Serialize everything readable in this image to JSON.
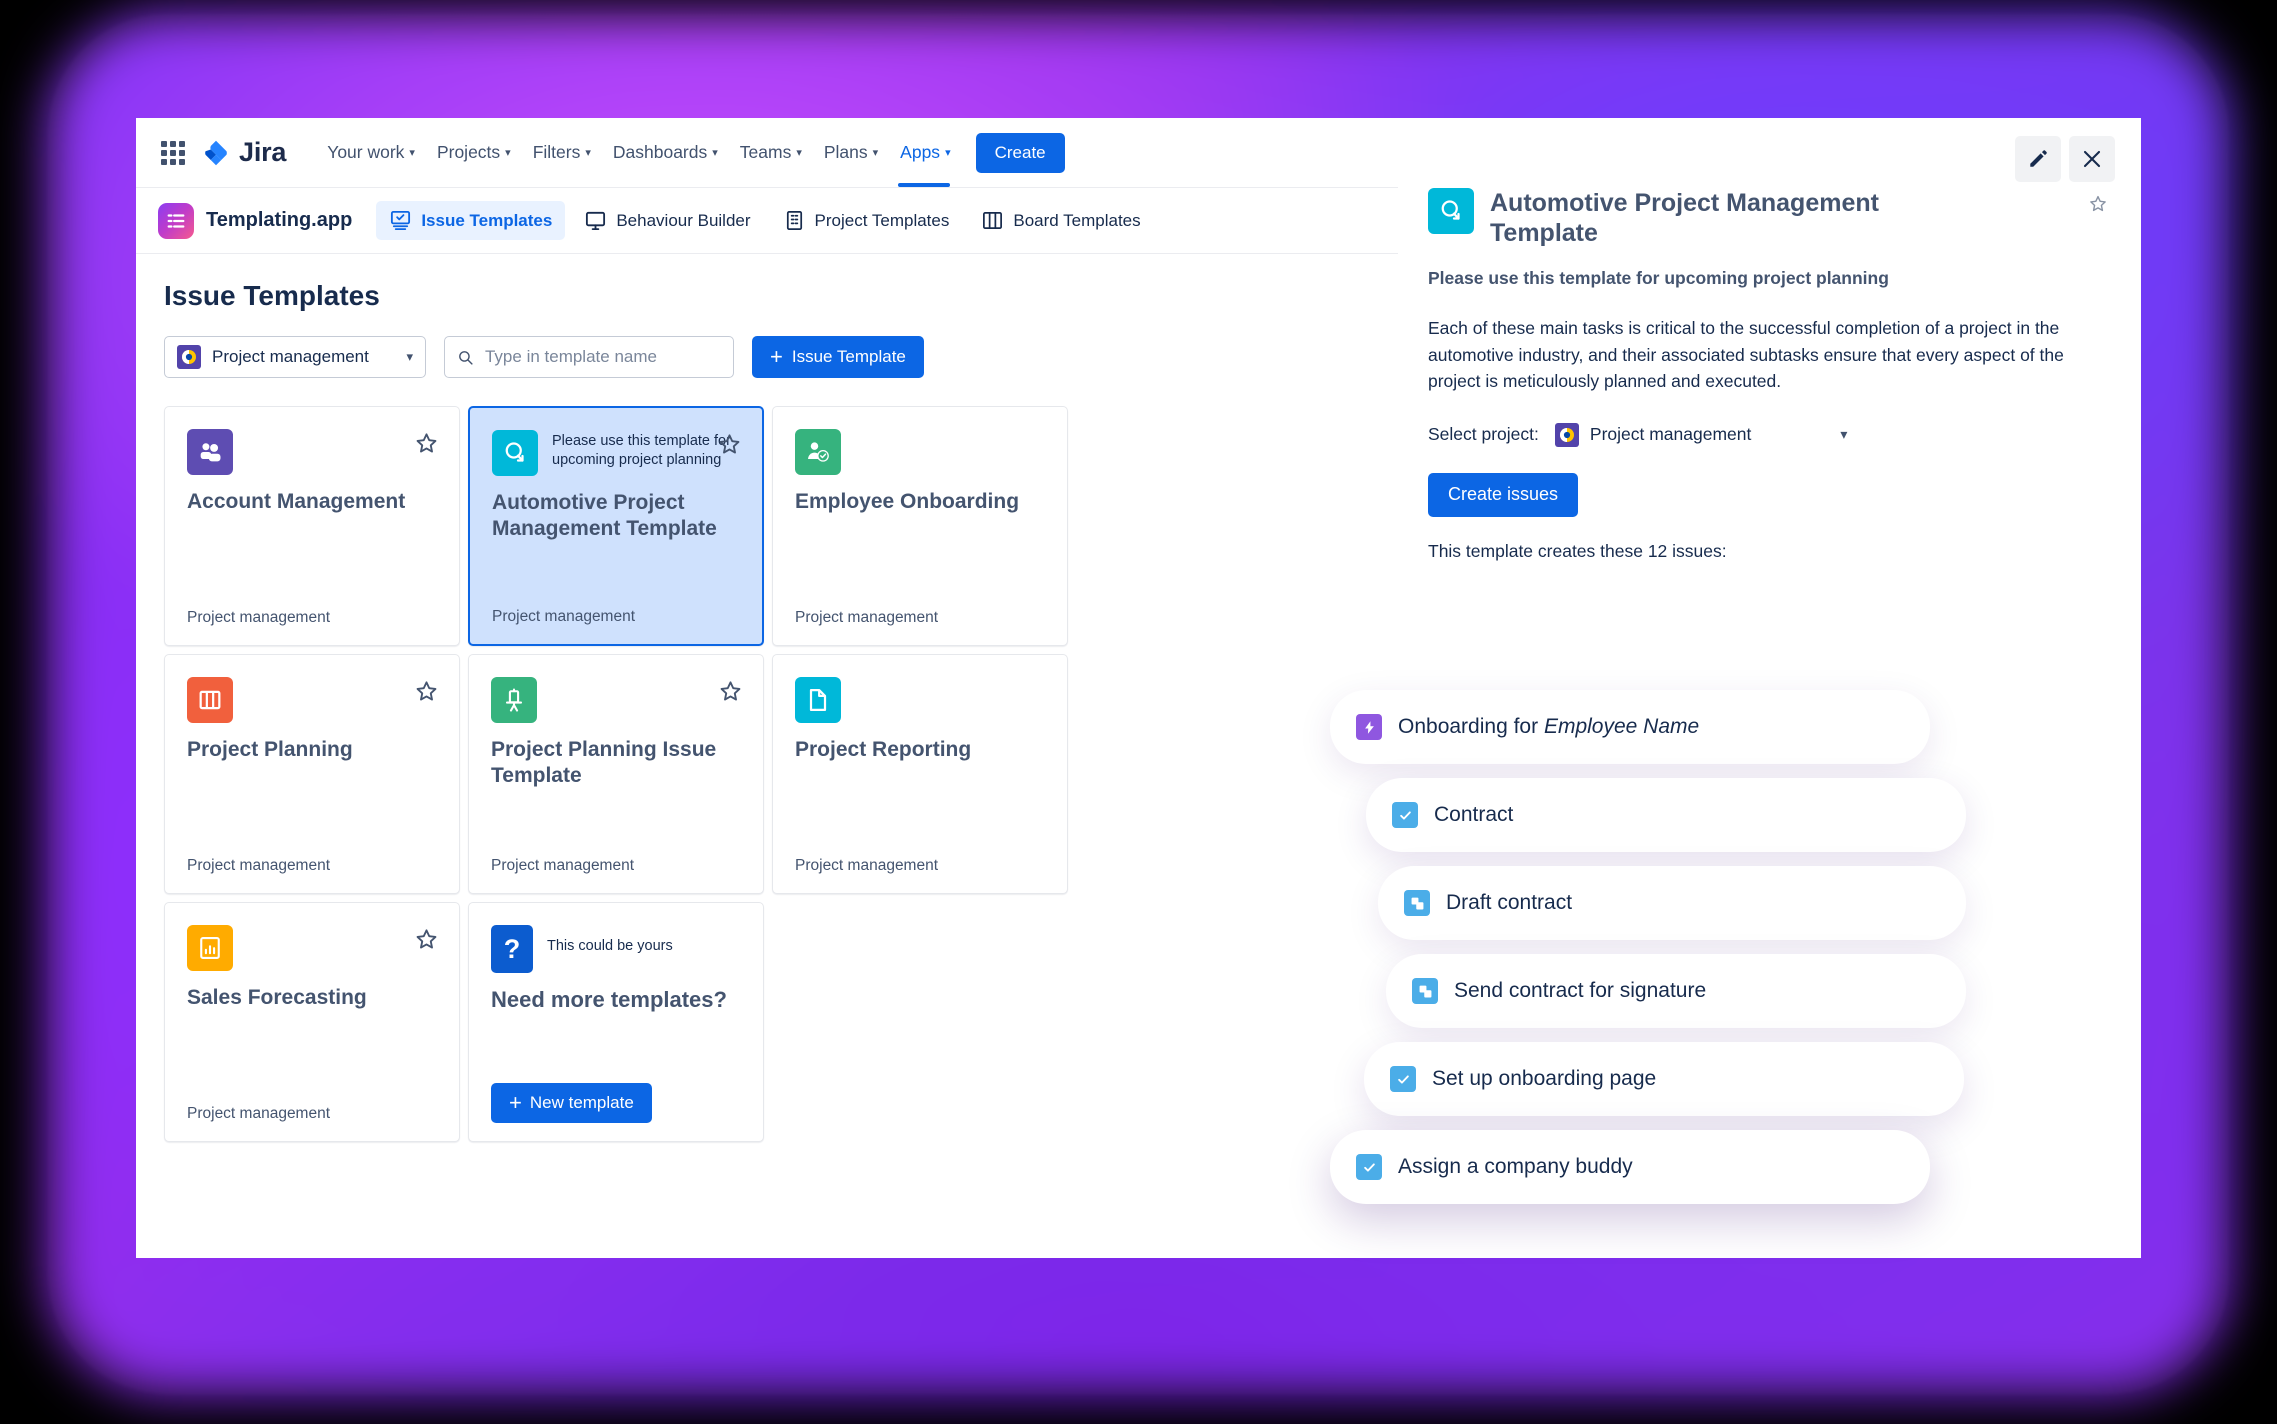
{
  "topnav": {
    "app_switcher": "app-switcher",
    "brand": "Jira",
    "items": [
      {
        "label": "Your work",
        "caret": "⌄",
        "active": false
      },
      {
        "label": "Projects",
        "caret": "⌄",
        "active": false
      },
      {
        "label": "Filters",
        "caret": "⌄",
        "active": false
      },
      {
        "label": "Dashboards",
        "caret": "⌄",
        "active": false
      },
      {
        "label": "Teams",
        "caret": "⌄",
        "active": false
      },
      {
        "label": "Plans",
        "caret": "⌄",
        "active": false
      },
      {
        "label": "Apps",
        "caret": "⌄",
        "active": true
      }
    ],
    "create_label": "Create"
  },
  "apptabs": {
    "app_name": "Templating.app",
    "tabs": [
      {
        "label": "Issue Templates",
        "icon": "issue-templates-icon",
        "active": true
      },
      {
        "label": "Behaviour Builder",
        "icon": "monitor-icon",
        "active": false
      },
      {
        "label": "Project Templates",
        "icon": "building-icon",
        "active": false
      },
      {
        "label": "Board Templates",
        "icon": "columns-icon",
        "active": false
      }
    ]
  },
  "page": {
    "title": "Issue Templates",
    "project_filter": "Project management",
    "search_placeholder": "Type in template name",
    "search_value": "",
    "add_button": "Issue Template"
  },
  "cards": [
    {
      "title": "Account Management",
      "note": "",
      "footer": "Project management",
      "icon": "people-icon",
      "icon_bg": "#5e4db2",
      "selected": false,
      "starred": false
    },
    {
      "title": "Automotive Project Management Template",
      "note": "Please use this template for upcoming project planning",
      "footer": "Project management",
      "icon": "automotive-icon",
      "icon_bg": "#00b8d9",
      "selected": true,
      "starred": false
    },
    {
      "title": "Employee Onboarding",
      "note": "",
      "footer": "Project management",
      "icon": "person-check-icon",
      "icon_bg": "#36b37e",
      "selected": false,
      "starred": false
    },
    {
      "title": "Project Planning",
      "note": "",
      "footer": "Project management",
      "icon": "board-icon",
      "icon_bg": "#f1603d",
      "selected": false,
      "starred": false
    },
    {
      "title": "Project Planning Issue Template",
      "note": "",
      "footer": "Project management",
      "icon": "easel-icon",
      "icon_bg": "#36b37e",
      "selected": false,
      "starred": false
    },
    {
      "title": "Project Reporting",
      "note": "",
      "footer": "Project management",
      "icon": "document-icon",
      "icon_bg": "#00b8d9",
      "selected": false,
      "starred": false
    },
    {
      "title": "Sales Forecasting",
      "note": "",
      "footer": "Project management",
      "icon": "chart-icon",
      "icon_bg": "#ffab00",
      "selected": false,
      "starred": false
    }
  ],
  "promo_card": {
    "note": "This could be yours",
    "title": "Need more templates?",
    "button": "New template",
    "icon": "question-mark-icon",
    "icon_bg": "#0c5ccf"
  },
  "detail": {
    "title": "Automotive Project Management Template",
    "subtitle": "Please use this template for upcoming project planning",
    "body": "Each of these main tasks is critical to the successful completion of a project in the automotive industry, and their associated subtasks ensure that every aspect of the project is meticulously planned and executed.",
    "select_project_label": "Select project:",
    "selected_project": "Project management",
    "create_issues_label": "Create issues",
    "creates_line": "This template creates these 12 issues:",
    "edit_icon": "pencil-icon",
    "close_icon": "close-icon",
    "star_icon": "star-icon"
  },
  "issues": [
    {
      "text": "Onboarding for ",
      "em": "Employee Name",
      "icon": "epic-icon",
      "icon_bg": "#8f57e0",
      "level": 0
    },
    {
      "text": "Contract",
      "em": "",
      "icon": "task-check-icon",
      "icon_bg": "#4bade8",
      "level": 1
    },
    {
      "text": "Draft contract",
      "em": "",
      "icon": "subtask-icon",
      "icon_bg": "#4bade8",
      "level": 2
    },
    {
      "text": "Send contract for signature",
      "em": "",
      "icon": "subtask-icon",
      "icon_bg": "#4bade8",
      "level": 3
    },
    {
      "text": "Set up onboarding page",
      "em": "",
      "icon": "task-check-icon",
      "icon_bg": "#4bade8",
      "level": 4
    },
    {
      "text": "Assign a company buddy",
      "em": "",
      "icon": "task-check-icon",
      "icon_bg": "#4bade8",
      "level": 5
    }
  ],
  "colors": {
    "accent": "#0c66e4",
    "selected_card_bg": "#cfe1fd",
    "text": "#172b4d",
    "muted": "#44546f",
    "backdrop": "#8a2be2"
  }
}
